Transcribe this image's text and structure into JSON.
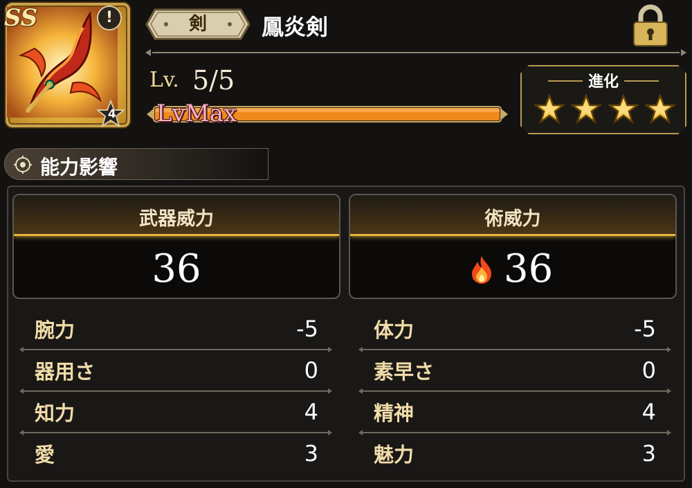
{
  "weapon": {
    "rank_badge": "SS",
    "evolution_count": "4",
    "type": "剣",
    "name": "鳳炎剣"
  },
  "level": {
    "label": "Lv.",
    "value": "5/5",
    "max_text": "LvMax",
    "progress": 1.0
  },
  "evolution": {
    "title": "進化",
    "stars": 4
  },
  "section": {
    "title": "能力影響"
  },
  "power": {
    "weapon_power_label": "武器威力",
    "weapon_power_value": "36",
    "magic_power_label": "術威力",
    "magic_power_value": "36",
    "magic_element_icon": "fire-icon"
  },
  "stats_left": [
    {
      "label": "腕力",
      "value": "-5"
    },
    {
      "label": "器用さ",
      "value": "0"
    },
    {
      "label": "知力",
      "value": "4"
    },
    {
      "label": "愛",
      "value": "3"
    }
  ],
  "stats_right": [
    {
      "label": "体力",
      "value": "-5"
    },
    {
      "label": "素早さ",
      "value": "0"
    },
    {
      "label": "精神",
      "value": "4"
    },
    {
      "label": "魅力",
      "value": "3"
    }
  ],
  "colors": {
    "gold": "#e5b43c",
    "label": "#f0dca8",
    "bar": "#f08a1c"
  }
}
